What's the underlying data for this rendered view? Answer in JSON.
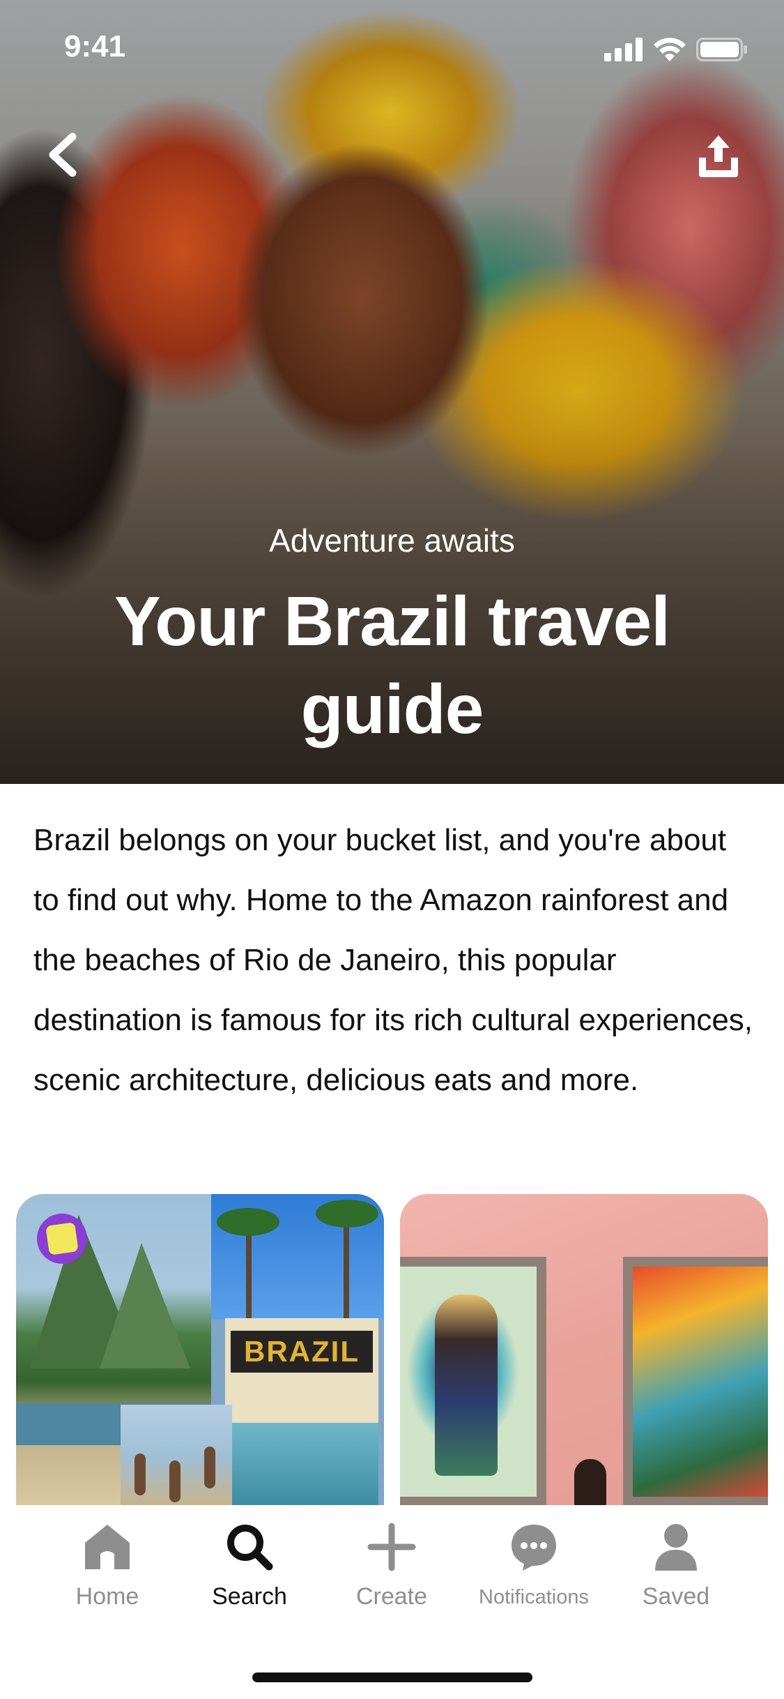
{
  "status_bar": {
    "time": "9:41",
    "icons": [
      "signal-icon",
      "wifi-icon",
      "battery-icon"
    ]
  },
  "header": {
    "back_icon": "chevron-left-icon",
    "share_icon": "share-upload-icon"
  },
  "hero": {
    "eyebrow": "Adventure awaits",
    "title": "Your Brazil travel guide"
  },
  "intro": {
    "text": "Brazil belongs on your bucket list, and you're about to find out why. Home to the Amazon rainforest and the beaches of Rio de Janeiro, this popular destination is famous for its rich cultural experiences, scenic architecture, delicious eats and more."
  },
  "pins": [
    {
      "poster_text": "BRAZIL",
      "badge_icon": "creator-badge-icon"
    },
    {
      "icon": "mural-photo"
    }
  ],
  "tabbar": {
    "tabs": [
      {
        "label": "Home",
        "icon": "home-icon",
        "active": false
      },
      {
        "label": "Search",
        "icon": "search-icon",
        "active": true
      },
      {
        "label": "Create",
        "icon": "plus-icon",
        "active": false
      },
      {
        "label": "Notifications",
        "icon": "chat-bubble-icon",
        "active": false
      },
      {
        "label": "Saved",
        "icon": "person-icon",
        "active": false
      }
    ]
  },
  "colors": {
    "active_tab": "#111111",
    "inactive_tab": "#8e8e8e",
    "badge": "#8a3ed4"
  }
}
